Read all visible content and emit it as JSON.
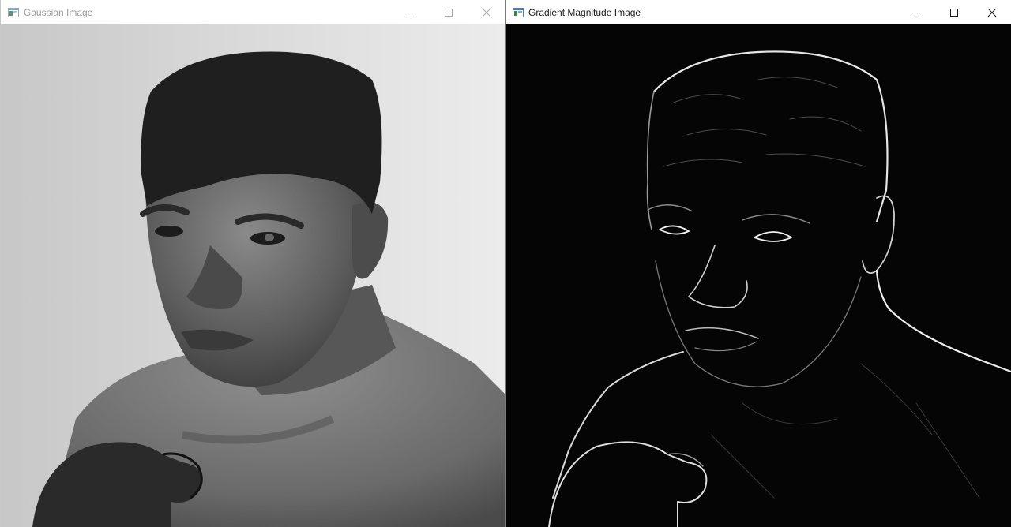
{
  "windows": [
    {
      "title": "Gaussian Image",
      "icon": "app-window-icon",
      "controls": [
        "minimize-icon",
        "maximize-icon",
        "close-icon"
      ],
      "content": "grayscale-portrait-image"
    },
    {
      "title": "Gradient Magnitude Image",
      "icon": "app-window-icon",
      "controls": [
        "minimize-icon",
        "maximize-icon",
        "close-icon"
      ],
      "content": "edge-detection-image"
    }
  ]
}
